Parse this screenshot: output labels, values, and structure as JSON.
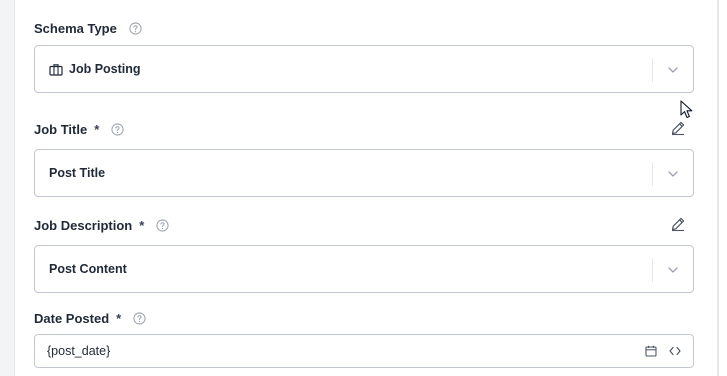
{
  "fields": {
    "schema_type": {
      "label": "Schema Type",
      "value": "Job Posting",
      "icon": "briefcase-icon"
    },
    "job_title": {
      "label": "Job Title",
      "required_mark": "*",
      "value": "Post Title"
    },
    "job_description": {
      "label": "Job Description",
      "required_mark": "*",
      "value": "Post Content"
    },
    "date_posted": {
      "label": "Date Posted",
      "required_mark": "*",
      "value": "{post_date}"
    }
  },
  "colors": {
    "border": "#c3c8d0",
    "text": "#1f2937",
    "icon": "#6b7280",
    "chevron": "#9ca3af"
  },
  "icons": [
    "help-icon",
    "edit-icon",
    "chevron-down-icon",
    "briefcase-icon",
    "calendar-icon",
    "code-icon",
    "mouse-cursor"
  ]
}
